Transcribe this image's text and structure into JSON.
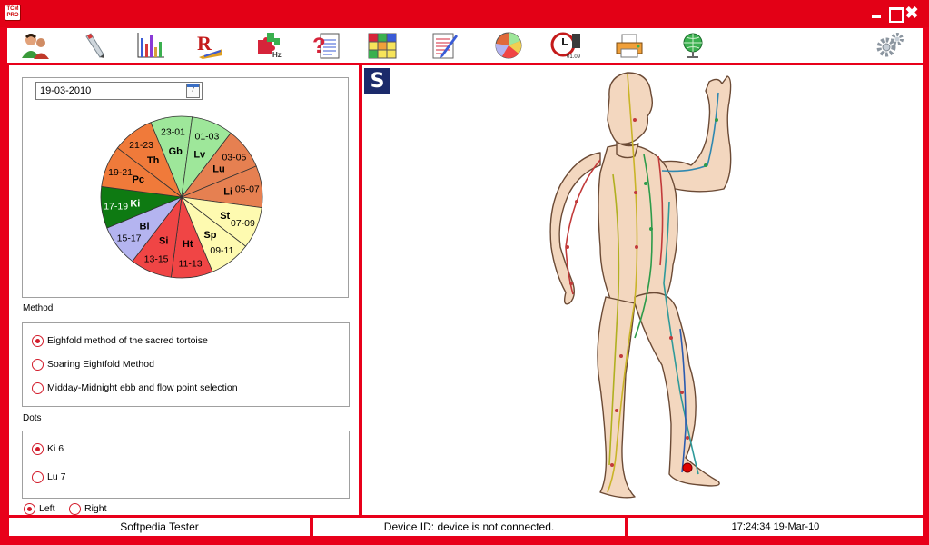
{
  "window": {
    "logo_text": "TCM PRO",
    "minimize": "",
    "maximize": "",
    "close": "✖"
  },
  "toolbar": {
    "icons": [
      "patients-icon",
      "pen-device-icon",
      "bar-chart-icon",
      "prescription-icon",
      "puzzle-hz-icon",
      "help-document-icon",
      "grid-table-icon",
      "notes-icon",
      "pie-chart-icon",
      "clock-icon",
      "printer-icon",
      "globe-icon",
      "settings-icon"
    ],
    "hz_label": "Hz",
    "clock_label": "01.09"
  },
  "calendar": {
    "date": "19-03-2010",
    "cal_icon_digit": "7"
  },
  "chart_data": {
    "type": "pie",
    "title": "",
    "slices": [
      {
        "organ": "Gb",
        "time": "23-01",
        "color": "#9ee79a",
        "value": 1
      },
      {
        "organ": "Lv",
        "time": "01-03",
        "color": "#9ee79a",
        "value": 1
      },
      {
        "organ": "Lu",
        "time": "03-05",
        "color": "#e68051",
        "value": 1
      },
      {
        "organ": "Li",
        "time": "05-07",
        "color": "#e68051",
        "value": 1
      },
      {
        "organ": "St",
        "time": "07-09",
        "color": "#fefab0",
        "value": 1
      },
      {
        "organ": "Sp",
        "time": "09-11",
        "color": "#fefab0",
        "value": 1
      },
      {
        "organ": "Ht",
        "time": "11-13",
        "color": "#f04545",
        "value": 1
      },
      {
        "organ": "Si",
        "time": "13-15",
        "color": "#f04545",
        "value": 1
      },
      {
        "organ": "Bl",
        "time": "15-17",
        "color": "#b4b4f0",
        "value": 1
      },
      {
        "organ": "Ki",
        "time": "17-19",
        "color": "#0e7a12",
        "value": 1
      },
      {
        "organ": "Pc",
        "time": "19-21",
        "color": "#f07a3a",
        "value": 1
      },
      {
        "organ": "Th",
        "time": "21-23",
        "color": "#f07a3a",
        "value": 1
      }
    ]
  },
  "method": {
    "label": "Method",
    "options": [
      {
        "text": "Eighfold method of the sacred tortoise",
        "selected": true
      },
      {
        "text": "Soaring Eightfold Method",
        "selected": false
      },
      {
        "text": "Midday-Midnight ebb and flow point selection",
        "selected": false
      }
    ]
  },
  "dots": {
    "label": "Dots",
    "options": [
      {
        "text": "Ki 6",
        "selected": true
      },
      {
        "text": "Lu 7",
        "selected": false
      }
    ]
  },
  "side": {
    "options": [
      {
        "text": "Left",
        "selected": true
      },
      {
        "text": "Right",
        "selected": false
      }
    ]
  },
  "viewer": {
    "logo_letter": "S"
  },
  "status": {
    "user": "Softpedia Tester",
    "device": "Device ID: device is not connected.",
    "time": "17:24:34",
    "date": "19-Mar-10"
  }
}
